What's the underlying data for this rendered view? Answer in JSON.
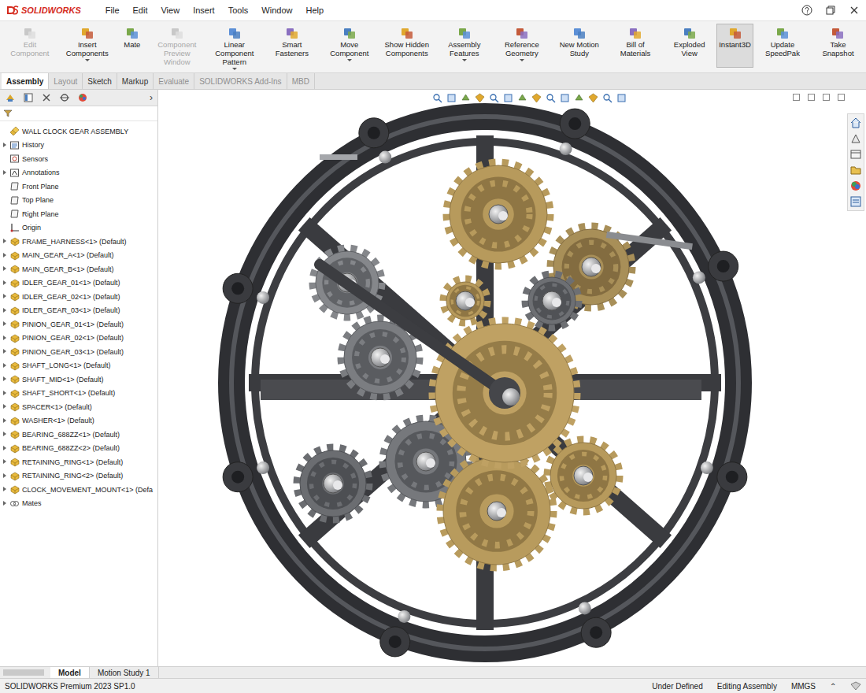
{
  "app": {
    "logo": "SOLIDWORKS"
  },
  "menu": [
    "File",
    "Edit",
    "View",
    "Insert",
    "Tools",
    "Window",
    "Help"
  ],
  "ribbon": [
    {
      "label": "Edit Component",
      "disabled": true,
      "selected": false,
      "dropdown": false
    },
    {
      "label": "Insert Components",
      "disabled": false,
      "selected": false,
      "dropdown": true
    },
    {
      "label": "Mate",
      "disabled": false,
      "selected": false,
      "dropdown": false
    },
    {
      "label": "Component Preview Window",
      "disabled": true,
      "selected": false,
      "dropdown": false
    },
    {
      "label": "Linear Component Pattern",
      "disabled": false,
      "selected": false,
      "dropdown": true
    },
    {
      "label": "Smart Fasteners",
      "disabled": false,
      "selected": false,
      "dropdown": false
    },
    {
      "label": "Move Component",
      "disabled": false,
      "selected": false,
      "dropdown": true
    },
    {
      "label": "Show Hidden Components",
      "disabled": false,
      "selected": false,
      "dropdown": false
    },
    {
      "label": "Assembly Features",
      "disabled": false,
      "selected": false,
      "dropdown": true
    },
    {
      "label": "Reference Geometry",
      "disabled": false,
      "selected": false,
      "dropdown": true
    },
    {
      "label": "New Motion Study",
      "disabled": false,
      "selected": false,
      "dropdown": false
    },
    {
      "label": "Bill of Materials",
      "disabled": false,
      "selected": false,
      "dropdown": false
    },
    {
      "label": "Exploded View",
      "disabled": false,
      "selected": false,
      "dropdown": false
    },
    {
      "label": "Instant3D",
      "disabled": false,
      "selected": true,
      "dropdown": false
    },
    {
      "label": "Update SpeedPak",
      "disabled": false,
      "selected": false,
      "dropdown": false
    },
    {
      "label": "Take Snapshot",
      "disabled": false,
      "selected": false,
      "dropdown": false
    }
  ],
  "tabs": [
    {
      "label": "Assembly",
      "selected": true,
      "disabled": false
    },
    {
      "label": "Layout",
      "selected": false,
      "disabled": true
    },
    {
      "label": "Sketch",
      "selected": false,
      "disabled": false
    },
    {
      "label": "Markup",
      "selected": false,
      "disabled": false
    },
    {
      "label": "Evaluate",
      "selected": false,
      "disabled": true
    },
    {
      "label": "SOLIDWORKS Add-Ins",
      "selected": false,
      "disabled": true
    },
    {
      "label": "MBD",
      "selected": false,
      "disabled": true
    }
  ],
  "panel": {
    "more": "›",
    "tree": [
      {
        "label": "WALL CLOCK GEAR ASSEMBLY",
        "kind": "root",
        "expandable": false
      },
      {
        "label": "History",
        "kind": "history",
        "expandable": true
      },
      {
        "label": "Sensors",
        "kind": "sensors",
        "expandable": false
      },
      {
        "label": "Annotations",
        "kind": "annotations",
        "expandable": true
      },
      {
        "label": "Front Plane",
        "kind": "plane",
        "expandable": false
      },
      {
        "label": "Top Plane",
        "kind": "plane",
        "expandable": false
      },
      {
        "label": "Right Plane",
        "kind": "plane",
        "expandable": false
      },
      {
        "label": "Origin",
        "kind": "origin",
        "expandable": false
      },
      {
        "label": "FRAME_HARNESS<1> (Default)",
        "kind": "component",
        "expandable": true
      },
      {
        "label": "MAIN_GEAR_A<1> (Default)",
        "kind": "component",
        "expandable": true
      },
      {
        "label": "MAIN_GEAR_B<1> (Default)",
        "kind": "component",
        "expandable": true
      },
      {
        "label": "IDLER_GEAR_01<1> (Default)",
        "kind": "component",
        "expandable": true
      },
      {
        "label": "IDLER_GEAR_02<1> (Default)",
        "kind": "component",
        "expandable": true
      },
      {
        "label": "IDLER_GEAR_03<1> (Default)",
        "kind": "component",
        "expandable": true
      },
      {
        "label": "PINION_GEAR_01<1> (Default)",
        "kind": "component",
        "expandable": true
      },
      {
        "label": "PINION_GEAR_02<1> (Default)",
        "kind": "component",
        "expandable": true
      },
      {
        "label": "PINION_GEAR_03<1> (Default)",
        "kind": "component",
        "expandable": true
      },
      {
        "label": "SHAFT_LONG<1> (Default)",
        "kind": "component",
        "expandable": true
      },
      {
        "label": "SHAFT_MID<1> (Default)",
        "kind": "component",
        "expandable": true
      },
      {
        "label": "SHAFT_SHORT<1> (Default)",
        "kind": "component",
        "expandable": true
      },
      {
        "label": "SPACER<1> (Default)",
        "kind": "component",
        "expandable": true
      },
      {
        "label": "WASHER<1> (Default)",
        "kind": "component",
        "expandable": true
      },
      {
        "label": "BEARING_688ZZ<1> (Default)",
        "kind": "component",
        "expandable": true
      },
      {
        "label": "BEARING_688ZZ<2> (Default)",
        "kind": "component",
        "expandable": true
      },
      {
        "label": "RETAINING_RING<1> (Default)",
        "kind": "component",
        "expandable": true
      },
      {
        "label": "RETAINING_RING<2> (Default)",
        "kind": "component",
        "expandable": true
      },
      {
        "label": "CLOCK_MOVEMENT_MOUNT<1> (Defa",
        "kind": "component",
        "expandable": true
      },
      {
        "label": "Mates",
        "kind": "mates",
        "expandable": true
      }
    ]
  },
  "bottom_tabs": [
    {
      "label": "Model",
      "selected": true
    },
    {
      "label": "Motion Study 1",
      "selected": false
    }
  ],
  "status_bar": {
    "product": "SOLIDWORKS Premium 2023 SP1.0",
    "items": [
      "Under Defined",
      "Editing Assembly",
      "MMGS"
    ],
    "toggle": "⌃"
  }
}
